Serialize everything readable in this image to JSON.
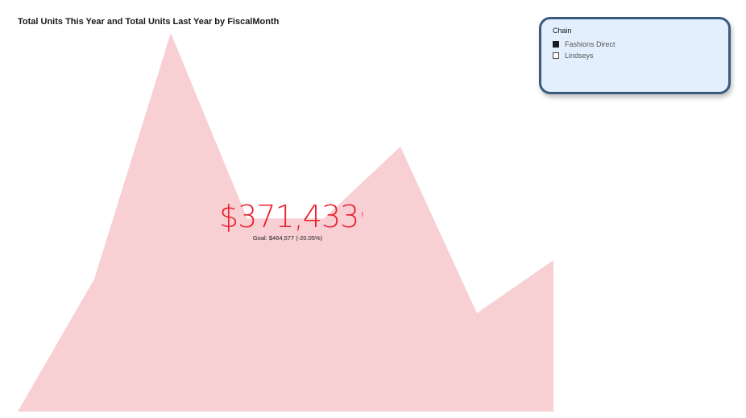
{
  "chart": {
    "title": "Total Units This Year and Total Units Last Year by FiscalMonth"
  },
  "kpi": {
    "value": "$371,433",
    "indicator": "!",
    "goal_text": "Goal: $464,577 (-20.05%)",
    "value_color": "#e8212f"
  },
  "slicer": {
    "header": "Chain",
    "items": [
      {
        "label": "Fashions Direct",
        "checked": true
      },
      {
        "label": "Lindseys",
        "checked": false
      }
    ]
  },
  "colors": {
    "area_fill": "#f8d0d4",
    "slicer_border": "#3a5a80",
    "slicer_background": "#e3effd"
  },
  "chart_data": {
    "type": "area",
    "title": "Total Units This Year and Total Units Last Year by FiscalMonth",
    "categories": [
      "",
      "",
      "",
      "",
      "",
      "",
      "",
      ""
    ],
    "values": [
      0,
      35,
      100,
      51,
      51,
      70,
      26,
      40
    ],
    "ylim": [
      0,
      100
    ],
    "grid": false,
    "axes_visible": false
  }
}
